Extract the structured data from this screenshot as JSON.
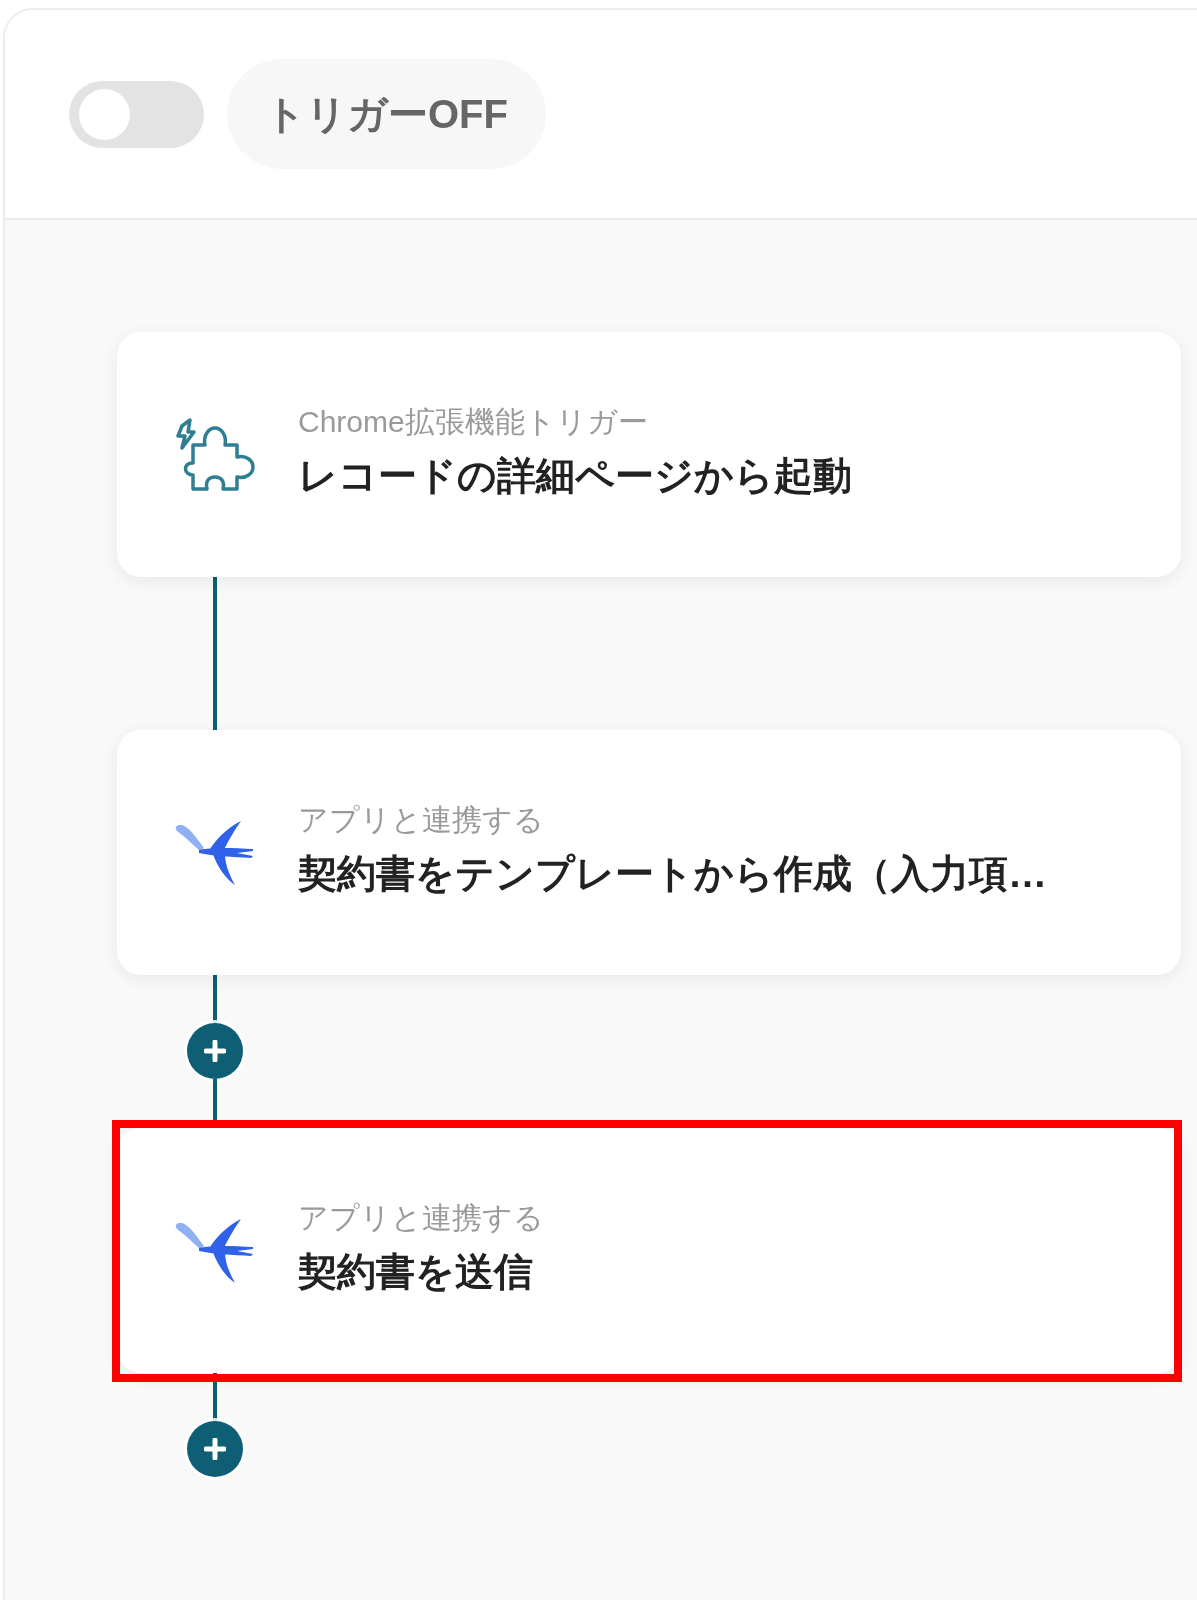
{
  "trigger": {
    "on": false,
    "status_label": "トリガーOFF"
  },
  "steps": [
    {
      "kind": "trigger",
      "category": "Chrome拡張機能トリガー",
      "title": "レコードの詳細ページから起動",
      "add_button_after": false,
      "highlighted": false
    },
    {
      "kind": "app",
      "category": "アプリと連携する",
      "title": "契約書をテンプレートから作成（入力項…",
      "add_button_after": true,
      "highlighted": false
    },
    {
      "kind": "app",
      "category": "アプリと連携する",
      "title": "契約書を送信",
      "add_button_after": true,
      "highlighted": true
    }
  ]
}
